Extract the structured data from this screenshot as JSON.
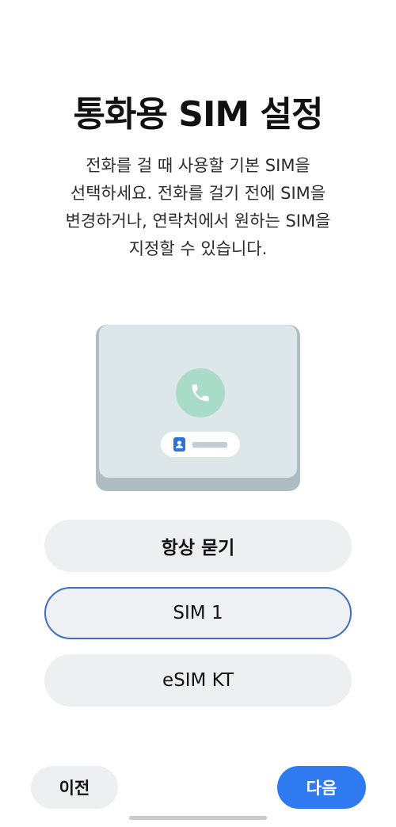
{
  "header": {
    "title": "통화용 SIM 설정"
  },
  "description": {
    "lines": [
      "전화를 걸 때 사용할 기본 SIM을",
      "선택하세요. 전화를 걸기 전에 SIM을",
      "변경하거나, 연락처에서 원하는 SIM을",
      "지정할 수 있습니다."
    ]
  },
  "illustration": {
    "icons": [
      "phone-call-icon",
      "contact-card-icon"
    ],
    "colors": {
      "phone_body": "#aebcc4",
      "screen": "#dde6e8",
      "call_circle": "#a9dcc8",
      "contact_icon": "#2c73d9"
    }
  },
  "options": [
    {
      "label": "항상 묻기",
      "selected": false
    },
    {
      "label": "SIM 1",
      "selected": true
    },
    {
      "label": "eSIM KT",
      "selected": false
    }
  ],
  "navigation": {
    "prev_label": "이전",
    "next_label": "다음"
  },
  "colors": {
    "accent": "#2f7af0",
    "selected_border": "#3a6fc4",
    "option_bg": "#eeeff1"
  }
}
